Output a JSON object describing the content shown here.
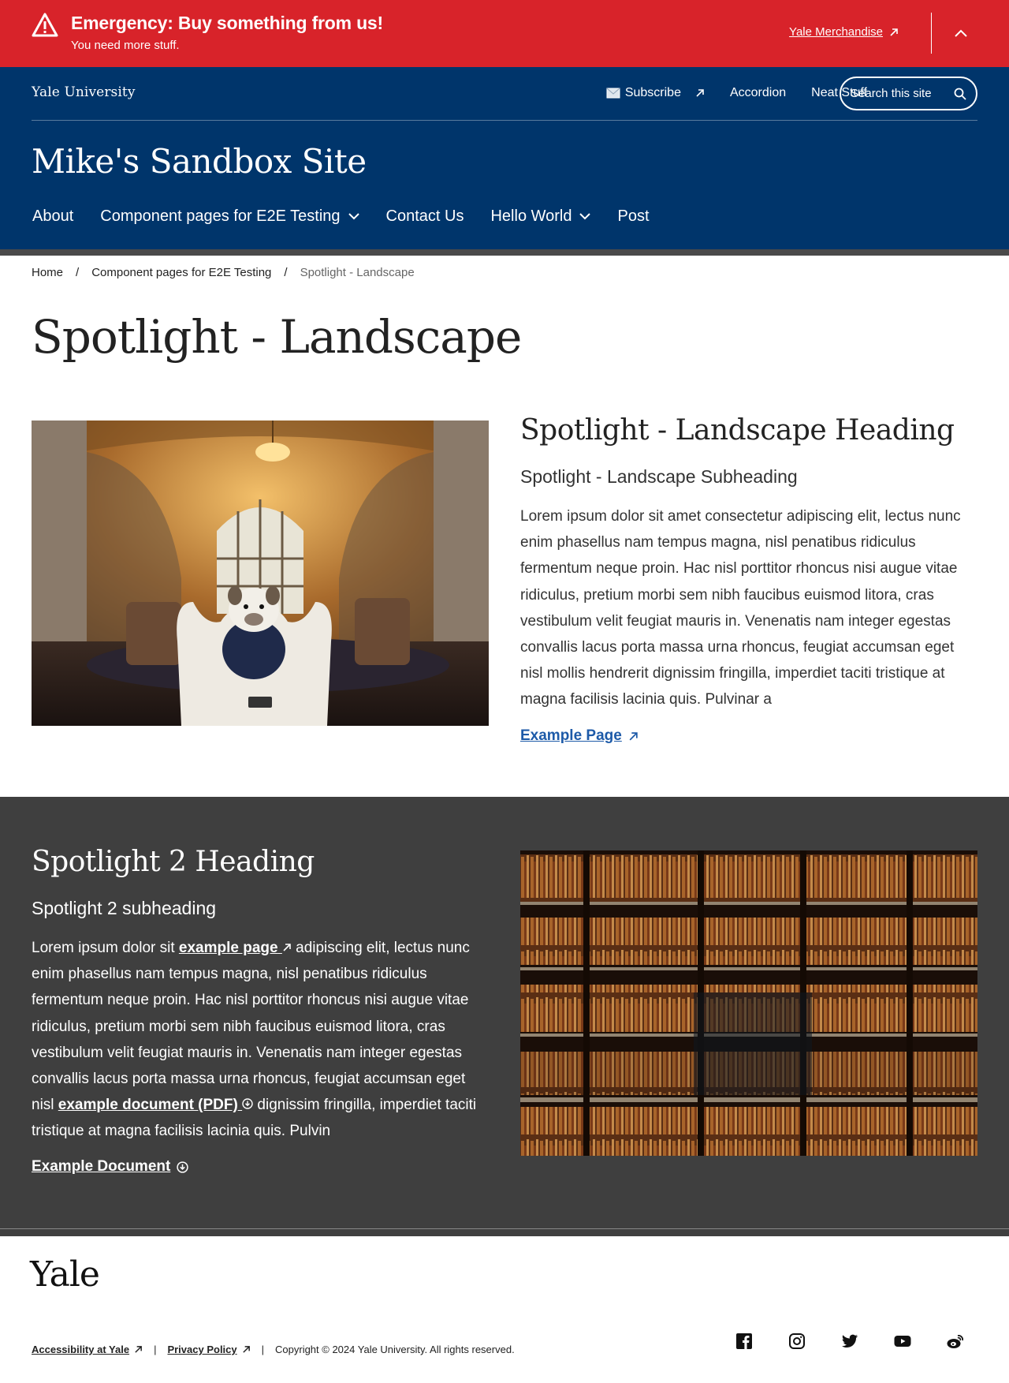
{
  "alert": {
    "title": "Emergency: Buy something from us!",
    "subtitle": "You need more stuff.",
    "link": "Yale Merchandise"
  },
  "header": {
    "university": "Yale University",
    "utility_nav": [
      "Subscribe",
      "Accordion",
      "Neat Stuff"
    ],
    "search_label": "Search this site",
    "site_title": "Mike's Sandbox Site",
    "main_nav": [
      "About",
      "Component pages for E2E Testing",
      "Contact Us",
      "Hello World",
      "Post"
    ]
  },
  "breadcrumb": [
    "Home",
    "Component pages for E2E Testing",
    "Spotlight - Landscape"
  ],
  "page_title": "Spotlight - Landscape",
  "spotlight1": {
    "heading": "Spotlight - Landscape Heading",
    "subheading": "Spotlight - Landscape Subheading",
    "body": "Lorem ipsum dolor sit amet consectetur adipiscing elit, lectus nunc enim phasellus nam tempus magna, nisl penatibus ridiculus fermentum neque proin. Hac nisl porttitor rhoncus nisi augue vitae ridiculus, pretium morbi sem nibh faucibus euismod litora, cras vestibulum velit feugiat mauris in. Venenatis nam integer egestas convallis lacus porta massa urna rhoncus, feugiat accumsan eget nisl mollis hendrerit dignissim fringilla, imperdiet taciti tristique at magna facilisis lacinia quis. Pulvinar a",
    "link": "Example Page",
    "image": "bulldog-in-library-photo"
  },
  "spotlight2": {
    "heading": "Spotlight 2 Heading",
    "subheading": "Spotlight 2 subheading",
    "body_part1": "Lorem ipsum dolor sit ",
    "inline_link1": "example page",
    "body_part2": " adipiscing elit, lectus nunc enim phasellus nam tempus magna, nisl penatibus ridiculus fermentum neque proin. Hac nisl porttitor rhoncus nisi augue vitae ridiculus, pretium morbi sem nibh faucibus euismod litora, cras vestibulum velit feugiat mauris in. Venenatis nam integer egestas convallis lacus porta massa urna rhoncus, feugiat accumsan eget nisl ",
    "inline_link2": "example document (PDF)",
    "body_part3": " dignissim fringilla, imperdiet taciti tristique at magna facilisis lacinia quis. Pulvin",
    "link": "Example Document",
    "image": "library-bookshelves-photo"
  },
  "footer": {
    "logo": "Yale",
    "links": [
      "Accessibility at Yale",
      "Privacy Policy"
    ],
    "copyright": "Copyright © 2024 Yale University. All rights reserved.",
    "social": [
      "facebook-icon",
      "instagram-icon",
      "twitter-icon",
      "youtube-icon",
      "weibo-icon"
    ]
  },
  "colors": {
    "alert_red": "#d8232a",
    "yale_blue": "#00356b",
    "dark_section": "#3f3f3f",
    "link_blue": "#1d5aa8"
  }
}
